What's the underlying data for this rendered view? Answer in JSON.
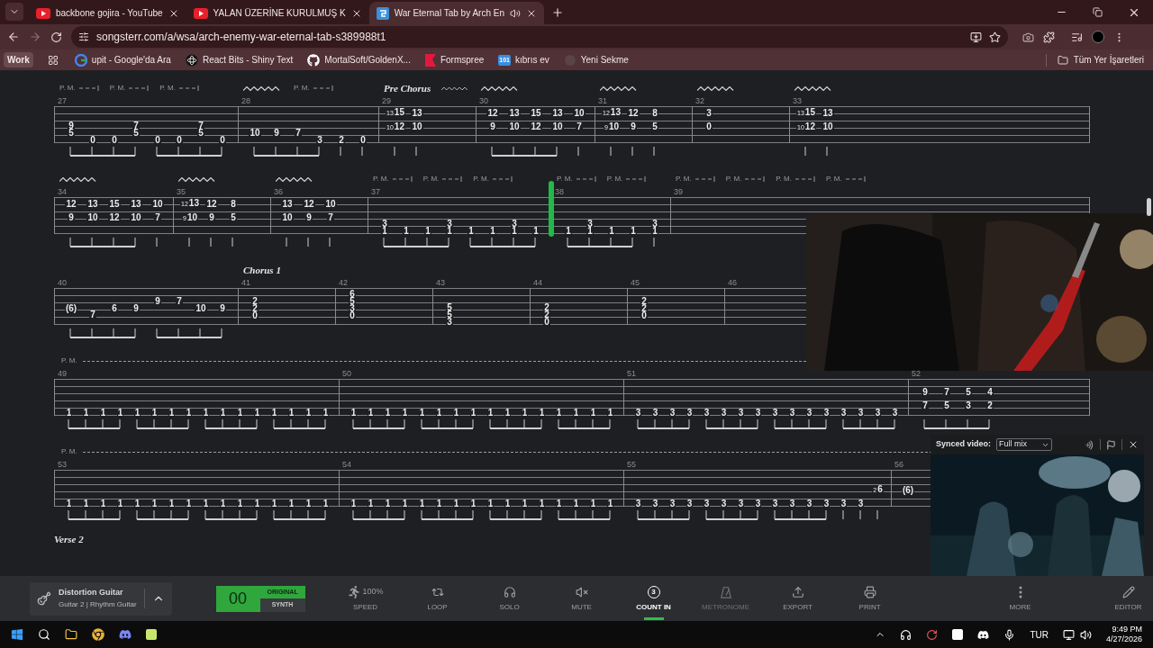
{
  "browser": {
    "tabs": [
      {
        "title": "backbone gojira - YouTube",
        "selected": false,
        "audio": false
      },
      {
        "title": "YALAN ÜZERİNE KURULMUŞ K",
        "selected": false,
        "audio": false
      },
      {
        "title": "War Eternal Tab by Arch En",
        "selected": true,
        "audio": true
      }
    ],
    "url": "songsterr.com/a/wsa/arch-enemy-war-eternal-tab-s389988t1",
    "profile_chip": "Work",
    "bookmarks": [
      {
        "label": "upit - Google'da Ara"
      },
      {
        "label": "React Bits - Shiny Text"
      },
      {
        "label": "MortalSoft/GoldenX..."
      },
      {
        "label": "Formspree"
      },
      {
        "label": "kıbrıs ev",
        "icon_text": "101"
      },
      {
        "label": "Yeni Sekme"
      }
    ],
    "all_bookmarks": "Tüm Yer İşaretleri"
  },
  "tab": {
    "systems": [
      {
        "measures": [
          {
            "number": "27",
            "marks": [
              {
                "kind": "pm",
                "text": "P. M."
              },
              {
                "kind": "pm",
                "text": "P. M."
              },
              {
                "kind": "pm",
                "text": "P. M."
              }
            ],
            "beats": [
              {
                "s4": "9",
                "s5": "5"
              },
              {
                "s6": "0"
              },
              {
                "s6": "0"
              },
              {
                "s4": "7",
                "s5": "5"
              },
              {
                "s6": "0"
              },
              {
                "s6": "0"
              },
              {
                "s4": "7",
                "s5": "5"
              },
              {
                "s6": "0"
              }
            ]
          },
          {
            "number": "28",
            "marks": [
              {
                "kind": "vibrato"
              },
              {
                "kind": "pm",
                "text": "P. M."
              }
            ],
            "beats": [
              {
                "s5": "10"
              },
              {
                "s5": "9"
              },
              {
                "s5": "7"
              },
              {
                "s6": "3"
              },
              {
                "s6": "2"
              },
              {
                "s6": "0"
              }
            ]
          },
          {
            "number": "29",
            "marks": [
              {
                "kind": "section",
                "text": "Pre Chorus"
              },
              {
                "kind": "vibrato"
              }
            ],
            "beats": [
              {
                "s2": "15",
                "g2": "13",
                "s4": "12",
                "g4": "10"
              },
              {
                "s2": "13",
                "s4": "10"
              }
            ]
          },
          {
            "number": "30",
            "marks": [
              {
                "kind": "vibrato"
              }
            ],
            "beats": [
              {
                "s2": "12",
                "s4": "9"
              },
              {
                "s2": "13",
                "s4": "10"
              },
              {
                "s2": "15",
                "s4": "12"
              },
              {
                "s2": "13",
                "s4": "10"
              },
              {
                "s2": "10",
                "s4": "7"
              }
            ]
          },
          {
            "number": "31",
            "marks": [
              {
                "kind": "vibrato"
              }
            ],
            "beats": [
              {
                "s2": "13",
                "g2": "12",
                "s4": "10",
                "g4": "9"
              },
              {
                "s2": "12",
                "s4": "9"
              },
              {
                "s2": "8",
                "s4": "5"
              }
            ]
          },
          {
            "number": "32",
            "marks": [
              {
                "kind": "vibrato"
              }
            ],
            "beats": [
              {
                "s2": "3",
                "s4": "0"
              }
            ]
          },
          {
            "number": "33",
            "marks": [
              {
                "kind": "vibrato"
              }
            ],
            "beats": [
              {
                "s2": "15",
                "g2": "13",
                "s4": "12",
                "g4": "10"
              },
              {
                "s2": "13",
                "s4": "10"
              }
            ]
          }
        ]
      },
      {
        "measures": [
          {
            "number": "34",
            "marks": [
              {
                "kind": "vibrato"
              }
            ],
            "beats": [
              {
                "s2": "12",
                "s4": "9"
              },
              {
                "s2": "13",
                "s4": "10"
              },
              {
                "s2": "15",
                "s4": "12"
              },
              {
                "s2": "13",
                "s4": "10"
              },
              {
                "s2": "10",
                "s4": "7"
              }
            ]
          },
          {
            "number": "35",
            "marks": [
              {
                "kind": "vibrato"
              }
            ],
            "beats": [
              {
                "s2": "13",
                "g2": "12",
                "s4": "10",
                "g4": "9"
              },
              {
                "s2": "12",
                "s4": "9"
              },
              {
                "s2": "8",
                "s4": "5"
              }
            ]
          },
          {
            "number": "36",
            "marks": [
              {
                "kind": "vibrato"
              }
            ],
            "beats": [
              {
                "s2": "13",
                "s4": "10"
              },
              {
                "s2": "12",
                "s4": "9"
              },
              {
                "s2": "10",
                "s4": "7"
              }
            ]
          },
          {
            "number": "37",
            "marks": [
              {
                "kind": "pm",
                "text": "P. M."
              },
              {
                "kind": "pm",
                "text": "P. M."
              },
              {
                "kind": "pm",
                "text": "P. M."
              }
            ],
            "beats": [
              {
                "s5": "3",
                "s6": "1"
              },
              {
                "s6": "1"
              },
              {
                "s6": "1"
              },
              {
                "s5": "3",
                "s6": "1"
              },
              {
                "s6": "1"
              },
              {
                "s6": "1"
              },
              {
                "s5": "3",
                "s6": "1"
              },
              {
                "s6": "1",
                "playhead": true
              }
            ]
          },
          {
            "number": "38",
            "marks": [
              {
                "kind": "pm",
                "text": "P. M."
              },
              {
                "kind": "pm",
                "text": "P. M."
              }
            ],
            "beats": [
              {
                "s6": "1"
              },
              {
                "s5": "3",
                "s6": "1"
              },
              {
                "s6": "1"
              },
              {
                "s6": "1"
              },
              {
                "s5": "3",
                "s6": "1"
              }
            ]
          },
          {
            "number": "39",
            "marks": [
              {
                "kind": "pm",
                "text": "P. M."
              },
              {
                "kind": "pm",
                "text": "P. M."
              },
              {
                "kind": "pm",
                "text": "P. M."
              },
              {
                "kind": "pm",
                "text": "P. M."
              }
            ]
          }
        ]
      },
      {
        "measures": [
          {
            "number": "40",
            "beats": [
              {
                "s4": "(6)"
              },
              {
                "s5": "7"
              },
              {
                "s4": "6"
              },
              {
                "s4": "9"
              },
              {
                "s3": "9"
              },
              {
                "s3": "7"
              },
              {
                "s4": "10"
              },
              {
                "s4": "9"
              }
            ]
          },
          {
            "number": "41",
            "marks": [
              {
                "kind": "section",
                "text": "Chorus 1"
              }
            ],
            "beats": [
              {
                "s3": "2",
                "s4": "2",
                "s5": "0"
              }
            ]
          },
          {
            "number": "42",
            "beats": [
              {
                "s2": "6",
                "s3": "5",
                "s4": "3",
                "s5": "0"
              }
            ]
          },
          {
            "number": "43",
            "beats": [
              {
                "s4": "5",
                "s5": "5",
                "s6": "3"
              }
            ]
          },
          {
            "number": "44",
            "beats": [
              {
                "s4": "2",
                "s5": "2",
                "s6": "0"
              }
            ]
          },
          {
            "number": "45",
            "beats": [
              {
                "s3": "2",
                "s4": "2",
                "s5": "0"
              }
            ]
          },
          {
            "number": "46"
          }
        ]
      },
      {
        "pm_line": "P. M.",
        "measures": [
          {
            "number": "49",
            "beats": [
              {
                "s6": "1"
              },
              {
                "s6": "1"
              },
              {
                "s6": "1"
              },
              {
                "s6": "1"
              },
              {
                "s6": "1"
              },
              {
                "s6": "1"
              },
              {
                "s6": "1"
              },
              {
                "s6": "1"
              },
              {
                "s6": "1"
              },
              {
                "s6": "1"
              },
              {
                "s6": "1"
              },
              {
                "s6": "1"
              },
              {
                "s6": "1"
              },
              {
                "s6": "1"
              },
              {
                "s6": "1"
              },
              {
                "s6": "1"
              }
            ]
          },
          {
            "number": "50",
            "beats": [
              {
                "s6": "1"
              },
              {
                "s6": "1"
              },
              {
                "s6": "1"
              },
              {
                "s6": "1"
              },
              {
                "s6": "1"
              },
              {
                "s6": "1"
              },
              {
                "s6": "1"
              },
              {
                "s6": "1"
              },
              {
                "s6": "1"
              },
              {
                "s6": "1"
              },
              {
                "s6": "1"
              },
              {
                "s6": "1"
              },
              {
                "s6": "1"
              },
              {
                "s6": "1"
              },
              {
                "s6": "1"
              },
              {
                "s6": "1"
              }
            ]
          },
          {
            "number": "51",
            "beats": [
              {
                "s6": "3"
              },
              {
                "s6": "3"
              },
              {
                "s6": "3"
              },
              {
                "s6": "3"
              },
              {
                "s6": "3"
              },
              {
                "s6": "3"
              },
              {
                "s6": "3"
              },
              {
                "s6": "3"
              },
              {
                "s6": "3"
              },
              {
                "s6": "3"
              },
              {
                "s6": "3"
              },
              {
                "s6": "3"
              },
              {
                "s6": "3"
              },
              {
                "s6": "3"
              },
              {
                "s6": "3"
              },
              {
                "s6": "3"
              }
            ]
          },
          {
            "number": "52",
            "beats": [
              {
                "s3": "9",
                "s5": "7"
              },
              {
                "s3": "7",
                "s5": "5"
              },
              {
                "s3": "5",
                "s5": "3"
              },
              {
                "s3": "4",
                "s5": "2"
              }
            ]
          }
        ]
      },
      {
        "pm_line": "P. M.",
        "measures": [
          {
            "number": "53",
            "beats": [
              {
                "s6": "1"
              },
              {
                "s6": "1"
              },
              {
                "s6": "1"
              },
              {
                "s6": "1"
              },
              {
                "s6": "1"
              },
              {
                "s6": "1"
              },
              {
                "s6": "1"
              },
              {
                "s6": "1"
              },
              {
                "s6": "1"
              },
              {
                "s6": "1"
              },
              {
                "s6": "1"
              },
              {
                "s6": "1"
              },
              {
                "s6": "1"
              },
              {
                "s6": "1"
              },
              {
                "s6": "1"
              },
              {
                "s6": "1"
              }
            ]
          },
          {
            "number": "54",
            "beats": [
              {
                "s6": "1"
              },
              {
                "s6": "1"
              },
              {
                "s6": "1"
              },
              {
                "s6": "1"
              },
              {
                "s6": "1"
              },
              {
                "s6": "1"
              },
              {
                "s6": "1"
              },
              {
                "s6": "1"
              },
              {
                "s6": "1"
              },
              {
                "s6": "1"
              },
              {
                "s6": "1"
              },
              {
                "s6": "1"
              },
              {
                "s6": "1"
              },
              {
                "s6": "1"
              },
              {
                "s6": "1"
              },
              {
                "s6": "1"
              }
            ]
          },
          {
            "number": "55",
            "beats": [
              {
                "s6": "3"
              },
              {
                "s6": "3"
              },
              {
                "s6": "3"
              },
              {
                "s6": "3"
              },
              {
                "s6": "3"
              },
              {
                "s6": "3"
              },
              {
                "s6": "3"
              },
              {
                "s6": "3"
              },
              {
                "s6": "3"
              },
              {
                "s6": "3"
              },
              {
                "s6": "3"
              },
              {
                "s6": "3"
              },
              {
                "s6": "3"
              },
              {
                "s6": "3"
              },
              {
                "s4": "6",
                "g4": "2"
              }
            ]
          },
          {
            "number": "56",
            "beats": [
              {
                "s4": "(6)"
              }
            ]
          }
        ]
      }
    ],
    "next_section": "Verse 2"
  },
  "synced_video": {
    "label": "Synced video:",
    "mix": "Full mix"
  },
  "player": {
    "instrument": "Distortion Guitar",
    "track": "Guitar 2 | Rhythm Guitar",
    "count": "00",
    "modes": [
      {
        "label": "ORIGINAL",
        "selected": true
      },
      {
        "label": "SYNTH",
        "selected": false
      }
    ],
    "tools": [
      {
        "label": "SPEED",
        "value": "100%",
        "selected": false,
        "disabled": false
      },
      {
        "label": "LOOP",
        "selected": false,
        "disabled": false
      },
      {
        "label": "SOLO",
        "selected": false,
        "disabled": false
      },
      {
        "label": "MUTE",
        "selected": false,
        "disabled": false
      },
      {
        "label": "COUNT IN",
        "icon_text": "3",
        "selected": true,
        "disabled": false
      },
      {
        "label": "METRONOME",
        "selected": false,
        "disabled": true
      },
      {
        "label": "EXPORT",
        "selected": false,
        "disabled": false
      },
      {
        "label": "PRINT",
        "selected": false,
        "disabled": false
      },
      {
        "label": "MORE",
        "selected": false,
        "disabled": false
      },
      {
        "label": "EDITOR",
        "selected": false,
        "disabled": false
      }
    ]
  },
  "taskbar": {
    "language": "TUR",
    "time": "9:49 PM",
    "date": "4/27/2026"
  }
}
